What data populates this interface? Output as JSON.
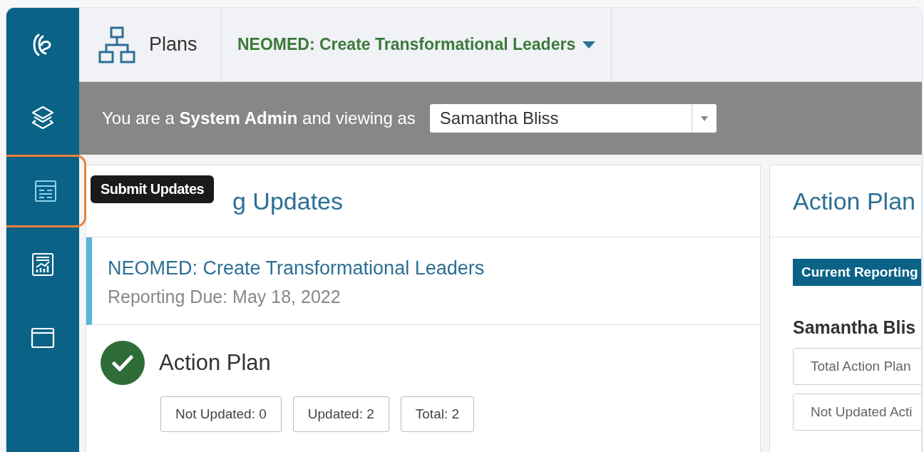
{
  "sidebar": {
    "items": [
      {
        "kind": "logo"
      },
      {
        "kind": "layers"
      },
      {
        "kind": "updates",
        "tooltip": "Submit Updates"
      },
      {
        "kind": "report"
      },
      {
        "kind": "window"
      }
    ]
  },
  "top_bar": {
    "section": "Plans",
    "plan_menu": "NEOMED: Create Transformational Leaders"
  },
  "banner": {
    "text": "You are a **System Admin** and viewing as",
    "viewing_as": "Samantha Bliss"
  },
  "pending": {
    "heading_visible": "g Updates",
    "plan_title": "NEOMED: Create Transformational Leaders",
    "due": "Reporting Due: May 18, 2022",
    "section": {
      "title": "Action Plan",
      "done": true,
      "counts": [
        "Not Updated: 0",
        "Updated: 2",
        "Total: 2"
      ]
    }
  },
  "right_panel": {
    "heading": "Action Plan",
    "badge": "Current Reporting",
    "name": "Samantha Blis",
    "rows": [
      "Total Action Plan",
      "Not Updated Acti"
    ]
  }
}
